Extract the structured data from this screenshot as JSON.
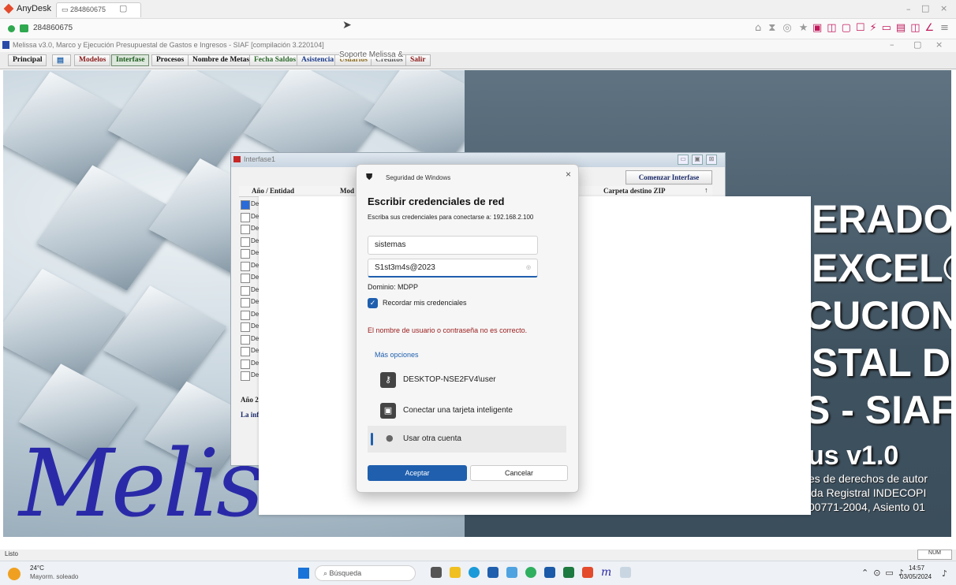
{
  "anydesk": {
    "app_name": "AnyDesk",
    "tab_label": "284860675",
    "address_id": "284860675",
    "win_controls": {
      "minimize": "–",
      "maximize": "□",
      "close": "×"
    },
    "remote_controls": {
      "minimize": "–",
      "restore": "▢",
      "close": "×"
    }
  },
  "app": {
    "title": "Melissa v3.0, Marco y Ejecución Presupuestal de Gastos e Ingresos - SIAF  [compilación 3.220104]",
    "menu": [
      {
        "label": "Principal",
        "color": "#111111"
      },
      {
        "label": "Modelos",
        "color": "#8b1a1a"
      },
      {
        "label": "Interfase",
        "color": "#1a5a1a"
      },
      {
        "label": "Procesos",
        "color": "#111111"
      },
      {
        "label": "Nombre de Metas",
        "color": "#111111"
      },
      {
        "label": "Fecha Saldos",
        "color": "#2a6a2a"
      },
      {
        "label": "Asistencia",
        "color": "#1a3a8b"
      },
      {
        "label": "Usuarios",
        "color": "#8b6a1a"
      },
      {
        "label": "Creditos",
        "color": "#555555"
      },
      {
        "label": "Salir",
        "color": "#8b1a1a"
      }
    ],
    "overlay_hint": "Soporte Melissa &",
    "status": "Listo",
    "num_indicator": "NUM"
  },
  "splash": {
    "lines": [
      "ERADOR",
      "EXCEL®",
      "CUCION",
      "STAL DE",
      "S - SIAF"
    ],
    "version": "us v1.0",
    "copyright": [
      "es de derechos de autor",
      "ida Registral INDECOPI",
      "00771-2004, Asiento 01"
    ],
    "script_text": "Melis"
  },
  "interfase": {
    "title": "Interfase1",
    "start_button": "Comenzar Interfase",
    "col_year": "Año / Entidad",
    "col_mod": "Mod",
    "col_zip": "Carpeta destino ZIP",
    "row_prefix": "De",
    "row_count": 15,
    "footer_year": "Año 2",
    "footer_info": "La inf"
  },
  "dialog": {
    "header": "Seguridad de Windows",
    "title": "Escribir credenciales de red",
    "subtitle": "Escriba sus credenciales para conectarse a: 192.168.2.100",
    "username": "sistemas",
    "password": "S1st3m4s@2023",
    "domain": "Dominio: MDPP",
    "remember": "Recordar mis credenciales",
    "error": "El nombre de usuario o contraseña no es correcto.",
    "more": "Más opciones",
    "options": [
      "DESKTOP-NSE2FV4\\user",
      "Conectar una tarjeta inteligente",
      "Usar otra cuenta"
    ],
    "accept": "Aceptar",
    "cancel": "Cancelar"
  },
  "taskbar": {
    "temp": "24°C",
    "weather": "Mayorm. soleado",
    "search": "Búsqueda",
    "time": "14:57",
    "date": "03/05/2024"
  }
}
